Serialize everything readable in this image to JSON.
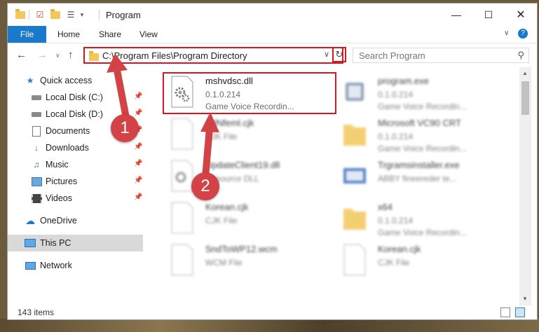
{
  "window": {
    "title": "Program"
  },
  "ribbon": {
    "tabs": [
      "File",
      "Home",
      "Share",
      "View"
    ]
  },
  "address_bar": {
    "path": "C:\\Program Files\\Program Directory"
  },
  "search": {
    "placeholder": "Search Program"
  },
  "sidebar": {
    "items": [
      {
        "label": "Quick access",
        "icon": "star-icon"
      },
      {
        "label": "Local Disk (C:)",
        "icon": "drive-icon"
      },
      {
        "label": "Local Disk (D:)",
        "icon": "drive-icon"
      },
      {
        "label": "Documents",
        "icon": "documents-icon"
      },
      {
        "label": "Downloads",
        "icon": "download-arrow-icon"
      },
      {
        "label": "Music",
        "icon": "music-note-icon"
      },
      {
        "label": "Pictures",
        "icon": "pictures-icon"
      },
      {
        "label": "Videos",
        "icon": "film-icon"
      },
      {
        "label": "OneDrive",
        "icon": "cloud-icon"
      },
      {
        "label": "This PC",
        "icon": "monitor-icon"
      },
      {
        "label": "Network",
        "icon": "network-icon"
      }
    ]
  },
  "files": [
    {
      "name": "mshvdsc.dll",
      "version": "0.1.0.214",
      "description": "Game Voice Recordin..."
    },
    {
      "name": "program.exe",
      "version": "0.1.0.214",
      "description": "Game Voice Recordin..."
    },
    {
      "name": "AdNfeml.cjk",
      "version": "",
      "description": "CJK File"
    },
    {
      "name": "Microsoft VC90 CRT",
      "version": "0.1.0.214",
      "description": "Game Voice Recordin..."
    },
    {
      "name": "UpdateClient19.dll",
      "version": "",
      "description": "Resource DLL"
    },
    {
      "name": "Trgramsinstaller.exe",
      "version": "",
      "description": "ABBY fineereder te..."
    },
    {
      "name": "Korean.cjk",
      "version": "",
      "description": "CJK File"
    },
    {
      "name": "x64",
      "version": "0.1.0.214",
      "description": "Game Voice Recordin..."
    },
    {
      "name": "SndToWP12.wcm",
      "version": "",
      "description": "WCM File"
    },
    {
      "name": "Korean.cjk",
      "version": "",
      "description": "CJK File"
    }
  ],
  "status": {
    "item_count": "143 items"
  },
  "annotations": {
    "badge1": "1",
    "badge2": "2",
    "color": "#d24246",
    "highlight_color": "#d9161f"
  }
}
